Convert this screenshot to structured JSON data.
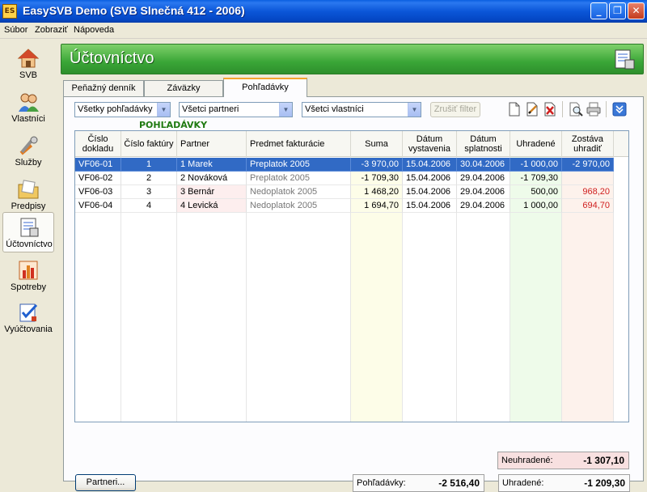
{
  "window": {
    "title": "EasySVB Demo  (SVB Slnečná 412 - 2006)",
    "icon_text": "ES"
  },
  "menu": [
    "Súbor",
    "Zobraziť",
    "Nápoveda"
  ],
  "nav": [
    {
      "label": "SVB",
      "icon": "house-icon"
    },
    {
      "label": "Vlastníci",
      "icon": "people-icon"
    },
    {
      "label": "Služby",
      "icon": "tools-icon"
    },
    {
      "label": "Predpisy",
      "icon": "folder-icon"
    },
    {
      "label": "Účtovníctvo",
      "icon": "ledger-icon"
    },
    {
      "label": "Spotreby",
      "icon": "bar-chart-icon"
    },
    {
      "label": "Vyúčtovania",
      "icon": "checklist-icon"
    }
  ],
  "header": {
    "title": "Účtovníctvo"
  },
  "tabs": [
    "Peňažný denník",
    "Záväzky",
    "Pohľadávky"
  ],
  "filters": {
    "type": "Všetky pohľadávky",
    "partner": "Všetci partneri",
    "owner": "Všetci vlastníci",
    "clear_button": "Zrušiť filter"
  },
  "section_title": "POHĽADÁVKY",
  "table": {
    "headers": [
      "Číslo dokladu",
      "Číslo faktúry",
      "Partner",
      "Predmet fakturácie",
      "Suma",
      "Dátum vystavenia",
      "Dátum splatnosti",
      "Uhradené",
      "Zostáva uhradiť"
    ],
    "rows": [
      [
        "VF06-01",
        "1",
        "1 Marek",
        "Preplatok 2005",
        "-3 970,00",
        "15.04.2006",
        "30.04.2006",
        "-1 000,00",
        "-2 970,00"
      ],
      [
        "VF06-02",
        "2",
        "2 Nováková",
        "Preplatok 2005",
        "-1 709,30",
        "15.04.2006",
        "29.04.2006",
        "-1 709,30",
        ""
      ],
      [
        "VF06-03",
        "3",
        "3 Bernár",
        "Nedoplatok 2005",
        "1 468,20",
        "15.04.2006",
        "29.04.2006",
        "500,00",
        "968,20"
      ],
      [
        "VF06-04",
        "4",
        "4 Levická",
        "Nedoplatok 2005",
        "1 694,70",
        "15.04.2006",
        "29.04.2006",
        "1 000,00",
        "694,70"
      ]
    ]
  },
  "footer": {
    "partners_button": "Partneri...",
    "receivables_label": "Pohľadávky:",
    "receivables_value": "-2 516,40",
    "paid_label": "Uhradené:",
    "paid_value": "-1 209,30",
    "unpaid_label": "Neuhradené:",
    "unpaid_value": "-1 307,10"
  },
  "colors": {
    "accent_green": "#3aa637",
    "selection": "#316ac5",
    "tab_highlight": "#f5a32c"
  }
}
